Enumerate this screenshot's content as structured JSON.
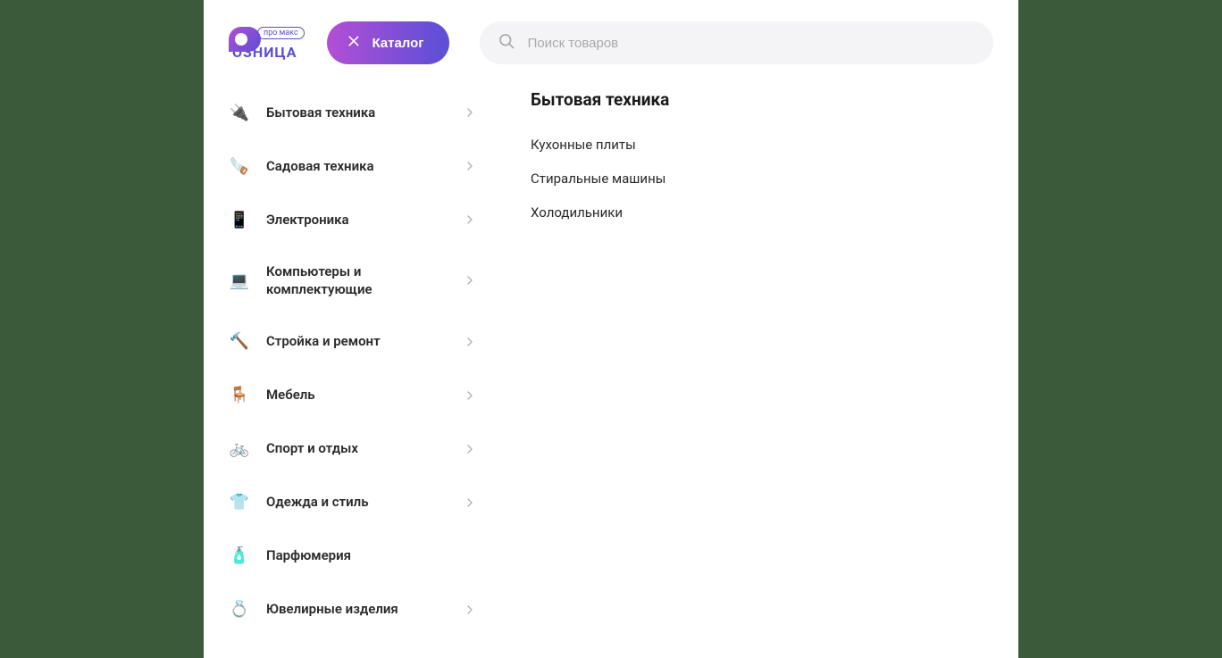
{
  "logo": {
    "badge": "про макс",
    "text": "ОЗНИЦА"
  },
  "header": {
    "catalog_button": "Каталог",
    "search_placeholder": "Поиск товаров"
  },
  "categories": [
    {
      "icon": "🔌",
      "label": "Бытовая техника"
    },
    {
      "icon": "🪚",
      "label": "Садовая техника"
    },
    {
      "icon": "📱",
      "label": "Электроника"
    },
    {
      "icon": "💻",
      "label": "Компьютеры и комплектующие"
    },
    {
      "icon": "🔨",
      "label": "Стройка и ремонт"
    },
    {
      "icon": "🪑",
      "label": "Мебель"
    },
    {
      "icon": "🚲",
      "label": "Спорт и отдых"
    },
    {
      "icon": "👕",
      "label": "Одежда и стиль"
    },
    {
      "icon": "🧴",
      "label": "Парфюмерия"
    },
    {
      "icon": "💍",
      "label": "Ювелирные изделия"
    }
  ],
  "subcategories": {
    "title": "Бытовая техника",
    "items": [
      "Кухонные плиты",
      "Стиральные машины",
      "Холодильники"
    ]
  }
}
